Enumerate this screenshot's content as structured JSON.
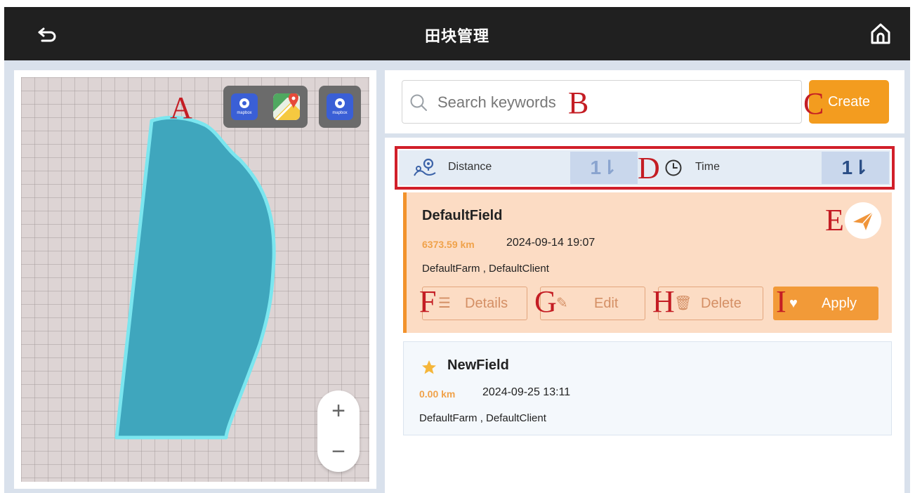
{
  "header": {
    "title": "田块管理",
    "back_icon": "back-arrow-icon",
    "home_icon": "home-icon"
  },
  "map": {
    "layer_buttons": [
      {
        "icon": "mapbox-icon",
        "label": "mapbox"
      },
      {
        "icon": "google-maps-icon",
        "label": ""
      },
      {
        "icon": "mapbox-icon",
        "label": "mapbox"
      }
    ],
    "zoom_in": "+",
    "zoom_out": "−",
    "field_color": "#3fa6bd",
    "field_outline": "#7be6ef"
  },
  "search": {
    "placeholder": "Search keywords",
    "icon": "search-icon"
  },
  "create_label": "Create",
  "sort": {
    "distance_label": "Distance",
    "distance_icon": "map-pin-route-icon",
    "distance_toggle": "1⇂",
    "time_label": "Time",
    "time_icon": "clock-icon",
    "time_toggle": "1⇂"
  },
  "fields": [
    {
      "name": "DefaultField",
      "distance": "6373.59 km",
      "time": "2024-09-14 19:07",
      "owner": "DefaultFarm , DefaultClient",
      "selected": true,
      "actions": {
        "details": "Details",
        "edit": "Edit",
        "delete": "Delete",
        "apply": "Apply"
      }
    },
    {
      "name": "NewField",
      "distance": "0.00 km",
      "time": "2024-09-25 13:11",
      "owner": "DefaultFarm , DefaultClient",
      "selected": false,
      "starred": true
    }
  ],
  "markers": {
    "A": "A",
    "B": "B",
    "C": "C",
    "D": "D",
    "E": "E",
    "F": "F",
    "G": "G",
    "H": "H",
    "I": "I"
  },
  "colors": {
    "accent": "#f39c1f",
    "highlight_border": "#d11f2a",
    "marker": "#c41d24",
    "selected_card": "#fcdcc4"
  }
}
